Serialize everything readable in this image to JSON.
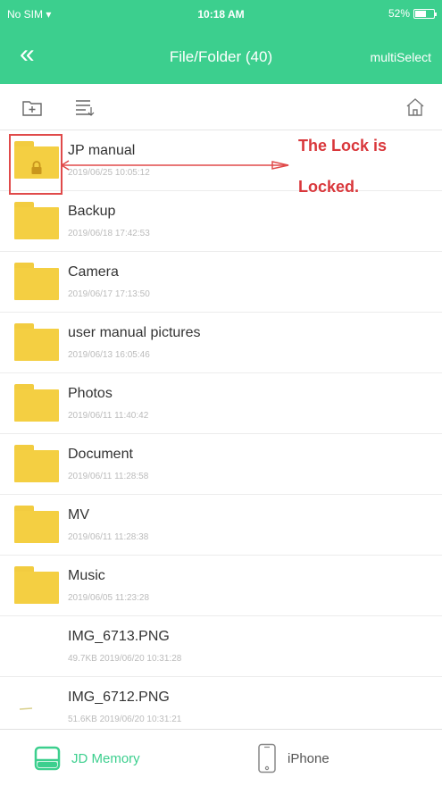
{
  "status_bar": {
    "carrier": "No SIM",
    "time": "10:18 AM",
    "battery": "52%"
  },
  "nav": {
    "back_label": "«",
    "title": "File/Folder (40)",
    "multiselect_label": "multiSelect"
  },
  "items": [
    {
      "name": "JP manual",
      "date": "2019/06/25 10:05:12"
    },
    {
      "name": "Backup",
      "date": "2019/06/18 17:42:53"
    },
    {
      "name": "Camera",
      "date": "2019/06/17 17:13:50"
    },
    {
      "name": "user manual pictures",
      "date": "2019/06/13 16:05:46"
    },
    {
      "name": "Photos",
      "date": "2019/06/11 11:40:42"
    },
    {
      "name": "Document",
      "date": "2019/06/11 11:28:58"
    },
    {
      "name": "MV",
      "date": "2019/06/11 11:28:38"
    },
    {
      "name": "Music",
      "date": "2019/06/05 11:23:28"
    },
    {
      "name": "IMG_6713.PNG",
      "date": "49.7KB 2019/06/20 10:31:28"
    },
    {
      "name": "IMG_6712.PNG",
      "date": "51.6KB 2019/06/20 10:31:21"
    }
  ],
  "annotation": {
    "line1": "The Lock is",
    "line2": "Locked."
  },
  "tabbar": {
    "tab1_label": "JD Memory",
    "tab2_label": "iPhone"
  },
  "colors": {
    "accent": "#3ccf8e",
    "folder": "#f4cf42",
    "annotation": "#d9373b"
  },
  "icons": [
    "wifi-icon",
    "battery-icon",
    "back-icon",
    "new-folder-icon",
    "sort-icon",
    "home-icon",
    "lock-icon",
    "folder-icon",
    "jd-memory-icon",
    "iphone-icon"
  ]
}
